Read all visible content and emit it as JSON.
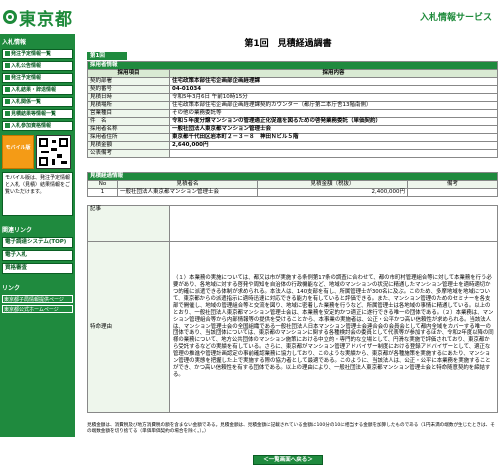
{
  "header": {
    "logo_text": "東京都",
    "site_title": "入札情報サービス"
  },
  "sidebar": {
    "section1": "入札情報",
    "menu": [
      "発注予定情報一覧",
      "入札公告情報",
      "発注予定情報",
      "入札結果・辞退情報",
      "入札関係一覧",
      "見積結果等情報一覧",
      "入札参加資格情報"
    ],
    "mobile_label": "モバイル版",
    "note": "モバイル版は、発注予定情報と入札（見積）結果情報をご覧いただけます。",
    "section2": "関連リンク",
    "links2": [
      "電子調達システム(TOP)",
      "電子入札",
      "資格審査"
    ],
    "section3": "リンク",
    "links3": [
      "東京都子局情報提供ページ",
      "東京都公式ホームページ"
    ]
  },
  "main": {
    "title": "第1回　見積経過調書",
    "tab": "第1回",
    "section_agency": "採用者情報",
    "col_item": "採用項目",
    "col_content": "採用内容",
    "rows": [
      {
        "label": "契約部署",
        "value": "住宅政策本部住宅企画部企画経理課",
        "bold": true
      },
      {
        "label": "契約番号",
        "value": "04-01034",
        "bold": true
      },
      {
        "label": "見積日時",
        "value": "令和5年3月6日 午前10時15分",
        "bold": false
      },
      {
        "label": "見積場所",
        "value": "住宅政策本部住宅企画部企画経理課契約カウンター（都庁第二本庁舎13階南側）",
        "bold": false
      },
      {
        "label": "営業種目",
        "value": "その他の業務委託等",
        "bold": false
      },
      {
        "label": "件　名",
        "value": "令和５年度分譲マンションの管理適正化促進を図るための啓発業務委託（単価契約）",
        "bold": true
      },
      {
        "label": "採用者名称",
        "value": "一般社団法人東京都マンション管理士会",
        "bold": true
      },
      {
        "label": "採用者住所",
        "value": "東京都千代田区岩本町２－３－８　神田Ｎビル５階",
        "bold": true
      },
      {
        "label": "見積金額",
        "value": "2,640,000円",
        "bold": true
      },
      {
        "label": "公表備考",
        "value": "",
        "bold": false
      }
    ],
    "section_results": "見積経過情報",
    "res_cols": [
      "No",
      "見積者名",
      "見積金額（税抜）",
      "備考"
    ],
    "res_rows": [
      {
        "no": "1",
        "name": "一般社団法人東京都マンション管理士会",
        "amount": "2,400,000円",
        "note": ""
      }
    ],
    "memo_label": "記事",
    "reason_label": "特命理由",
    "reason_text": "（１）本業務の実施については、都又は市が実施する条例第17条の調査に合わせて、都の市町村管理組合等に対して本業務を行う必要があり、各地域に対する啓発や周知を自治体の行政機能など、地域のマンションの状況に精通したマンション管理士を適時適切かつ的確に派遣できる体制が求められる。本法人は、140支部を有し、所属管理士が300名に及ぶ。このため、多摩地域を地域について、東京都からの派遣指示に適時迅速に対応できる能力を有していると評価できる。また、マンション管理のためのセミナーを各支部で開催し、地域の管理組合等と交流を図り、地域に密着した業務を行うなど、所属管理士は各地域の事情に精通している。以上のとおり、一般社団法人東京都マンション管理士会は、本業務を安定的かつ適正に遂行できる唯一の団体である。（２）本業務は、マンション管理組合等から内部情報等の提供を受けることから、本事業の実施者は、公正・公平かつ高い信頼性が求められる。当該法人は、マンション管理士会の全国組織である一般社団法人日本マンション管理士会連合会の会員会として都内全域をカバーする唯一の団体であり、当該団体については、東京都のマンションに関する各種検討会の委員として代表等が参加するほか、令和2年度以降の同様の業務について、地方公共団体のマンション施策における中立的・専門的な立場として、円滑な実施で評価されており、東京都から受託するなどの実績を有している。さらに、東京都がマンション管理アドバイザー制度における登録アドバイザーとして、適正な管理の推進や管理計画認定の事前確認業務に協力しており、このような実績から、東京都が各種施策を実施するにあたり、マンション管理の実態を把握した上で実施する際の協力者として最適である。このように、当該法人は、公正・公平に本業務を実施することができ、かつ高い信頼性を有する団体である。以上の理由により、一般社団法人東京都マンション管理士会と特命随意契約を締結する。",
    "notes": "見積金額は、消費税及び地方消費税の額を含まない金額である。見積金額は、見積金額に記載されている金額に100分の10に相当する金額を加算したものである（1円未満の端数が生じたときは、その端数金額を切り捨てる（単価単価契約の場合を除く。）。）",
    "back_label": "＜一覧画面へ戻る＞"
  },
  "colors": {
    "accent": "#1f8a3e",
    "header_text": "#1d8a3a",
    "mobile": "#f49b16"
  }
}
